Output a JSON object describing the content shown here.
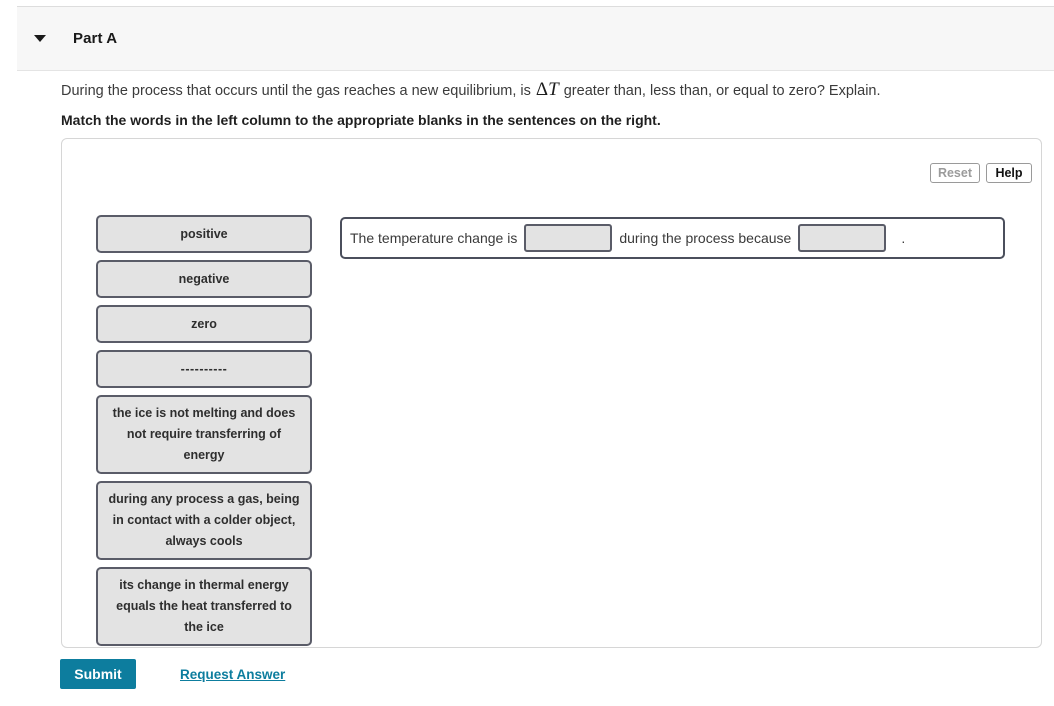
{
  "header": {
    "caret_icon": "chevron-down-icon",
    "title": "Part A"
  },
  "question": {
    "text_before_math": "During the process that occurs until the gas reaches a new equilibrium, is ",
    "math_delta": "Δ",
    "math_var": "T",
    "text_after_math": " greater than, less than, or equal to zero? Explain.",
    "instruction": "Match the words in the left column to the appropriate blanks in the sentences on the right."
  },
  "toolbar": {
    "reset_label": "Reset",
    "help_label": "Help"
  },
  "word_bank": {
    "tiles": [
      {
        "label": "positive",
        "type": "short"
      },
      {
        "label": "negative",
        "type": "short"
      },
      {
        "label": "zero",
        "type": "short"
      },
      {
        "label": "----------",
        "type": "dashes"
      },
      {
        "label": "the ice is not melting and does not require transferring of energy",
        "type": "long"
      },
      {
        "label": "during any process a gas, being in contact with a colder object, always cools",
        "type": "long"
      },
      {
        "label": "its change in thermal energy equals the heat transferred to the ice",
        "type": "long"
      }
    ]
  },
  "sentence": {
    "part1": "The temperature change is",
    "blank1_value": "",
    "part2": "during the process because",
    "blank2_value": "",
    "period": "."
  },
  "footer": {
    "submit_label": "Submit",
    "request_answer_label": "Request Answer"
  },
  "colors": {
    "accent": "#0d7d9e",
    "tile_fill": "#e3e3e3",
    "tile_border": "#5a5c68",
    "header_bg": "#f7f7f7"
  }
}
